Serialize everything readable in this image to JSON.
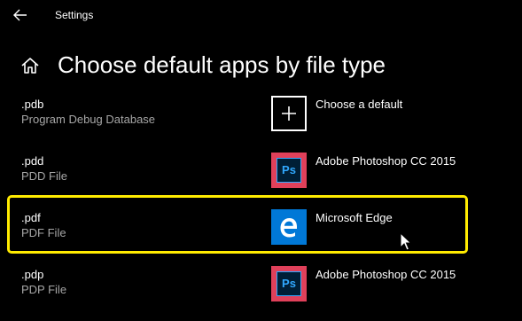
{
  "window": {
    "title": "Settings",
    "back_icon": "back-arrow-icon"
  },
  "page": {
    "home_icon": "home-icon",
    "title": "Choose default apps by file type"
  },
  "file_types": [
    {
      "extension": ".pdb",
      "description": "Program Debug Database",
      "app_name": "Choose a default",
      "app_icon": "plus-icon"
    },
    {
      "extension": ".pdd",
      "description": "PDD File",
      "app_name": "Adobe Photoshop CC 2015",
      "app_icon": "photoshop-icon",
      "icon_text": "Ps"
    },
    {
      "extension": ".pdf",
      "description": "PDF File",
      "app_name": "Microsoft Edge",
      "app_icon": "edge-icon",
      "highlighted": true
    },
    {
      "extension": ".pdp",
      "description": "PDP File",
      "app_name": "Adobe Photoshop CC 2015",
      "app_icon": "photoshop-icon",
      "icon_text": "Ps"
    }
  ],
  "colors": {
    "background": "#000000",
    "secondary_text": "#a6a6a6",
    "highlight_border": "#ffeb00",
    "edge_blue": "#0078d7",
    "photoshop_frame": "#e0405a",
    "photoshop_bg": "#001e36",
    "photoshop_accent": "#31a8ff"
  }
}
